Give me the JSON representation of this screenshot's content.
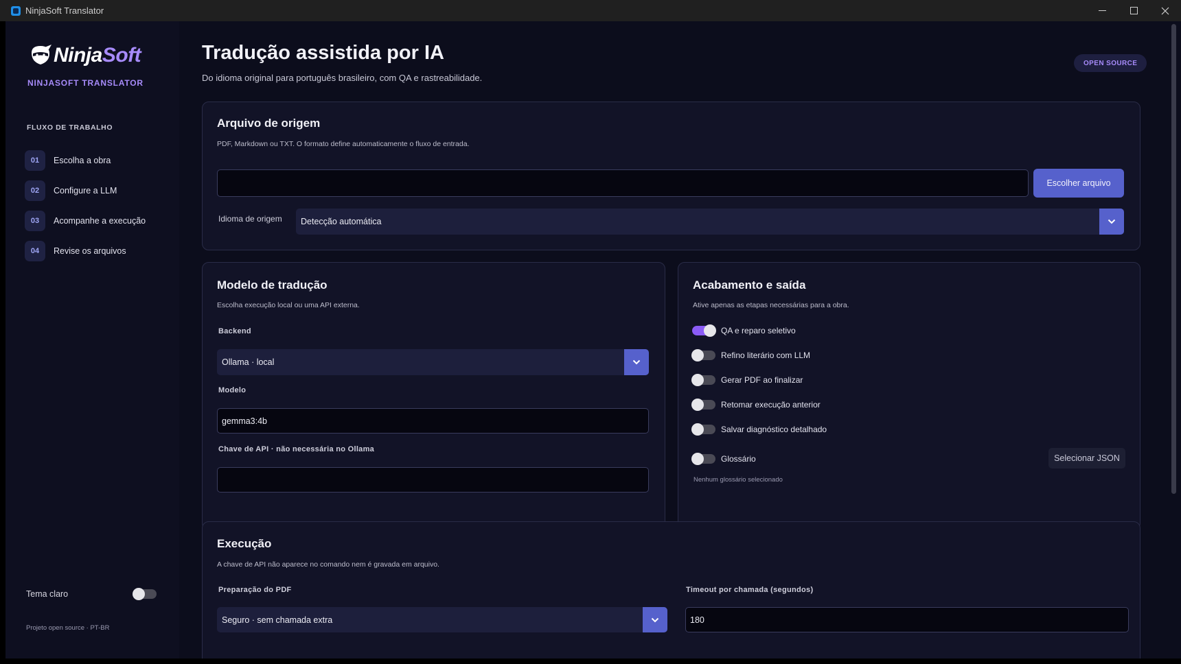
{
  "window": {
    "title": "NinjaSoft Translator"
  },
  "sidebar": {
    "logo_white": "Ninja",
    "logo_purple": "Soft",
    "brand_sub": "NINJASOFT TRANSLATOR",
    "section": "FLUXO DE TRABALHO",
    "steps": [
      {
        "num": "01",
        "label": "Escolha a obra"
      },
      {
        "num": "02",
        "label": "Configure a LLM"
      },
      {
        "num": "03",
        "label": "Acompanhe a execução"
      },
      {
        "num": "04",
        "label": "Revise os arquivos"
      }
    ],
    "theme_label": "Tema claro",
    "theme_on": false,
    "footer": "Projeto open source · PT-BR"
  },
  "header": {
    "title": "Tradução assistida por IA",
    "subtitle": "Do idioma original para português brasileiro, com QA e rastreabilidade.",
    "badge": "OPEN SOURCE"
  },
  "source": {
    "title": "Arquivo de origem",
    "desc": "PDF, Markdown ou TXT. O formato define automaticamente o fluxo de entrada.",
    "file_value": "",
    "choose_button": "Escolher arquivo",
    "lang_label": "Idioma de origem",
    "lang_value": "Detecção automática"
  },
  "model": {
    "title": "Modelo de tradução",
    "desc": "Escolha execução local ou uma API externa.",
    "backend_label": "Backend",
    "backend_value": "Ollama · local",
    "model_label": "Modelo",
    "model_value": "gemma3:4b",
    "apikey_label": "Chave de API · não necessária no Ollama",
    "apikey_value": ""
  },
  "output": {
    "title": "Acabamento e saída",
    "desc": "Ative apenas as etapas necessárias para a obra.",
    "options": [
      {
        "label": "QA e reparo seletivo",
        "on": true
      },
      {
        "label": "Refino literário com LLM",
        "on": false
      },
      {
        "label": "Gerar PDF ao finalizar",
        "on": false
      },
      {
        "label": "Retomar execução anterior",
        "on": false
      },
      {
        "label": "Salvar diagnóstico detalhado",
        "on": false
      }
    ],
    "glossary_label": "Glossário",
    "glossary_on": false,
    "glossary_button": "Selecionar JSON",
    "glossary_status": "Nenhum glossário selecionado"
  },
  "execution": {
    "title": "Execução",
    "desc": "A chave de API não aparece no comando nem é gravada em arquivo.",
    "prep_label": "Preparação do PDF",
    "prep_value": "Seguro · sem chamada extra",
    "timeout_label": "Timeout por chamada (segundos)",
    "timeout_value": "180"
  },
  "colors": {
    "accent": "#5661cc",
    "brand_purple": "#a78bfa",
    "toggle_on": "#8b5cf6"
  },
  "icons": {
    "logo": "ninja-logo-icon",
    "chevron": "chevron-down-icon",
    "minimize": "minimize-icon",
    "maximize": "maximize-icon",
    "close": "close-icon"
  }
}
